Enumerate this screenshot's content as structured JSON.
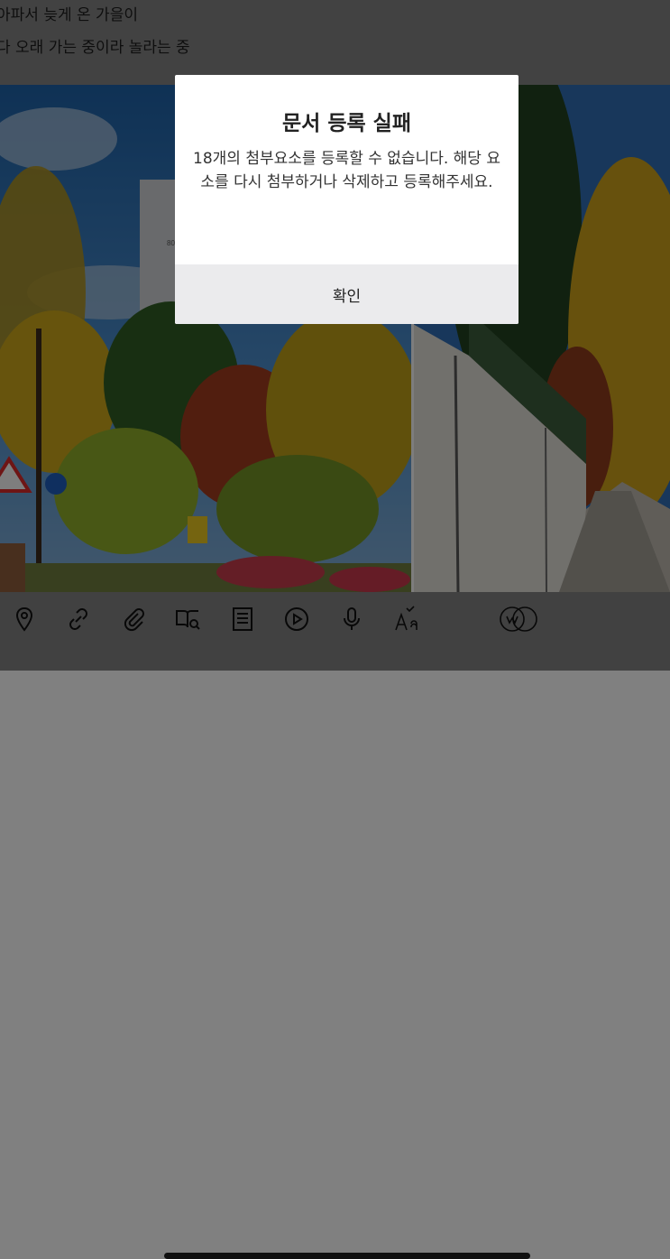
{
  "editor": {
    "line1": "아파서 늦게 온 가을이",
    "line2": "다 오래 가는 중이라 놀라는 중"
  },
  "dialog": {
    "title": "문서 등록 실패",
    "message": "18개의 첨부요소를 등록할 수 없습니다. 해당 요소를 다시 첨부하거나 삭제하고 등록해주세요.",
    "confirm_label": "확인"
  },
  "photo": {
    "left_sign_text": "80"
  },
  "toolbar": {
    "icons": [
      "location-pin-icon",
      "link-icon",
      "paperclip-icon",
      "book-search-icon",
      "document-icon",
      "video-play-icon",
      "microphone-icon",
      "spellcheck-icon",
      "ai-writing-icon"
    ]
  },
  "colors": {
    "dialog_bg": "#ffffff",
    "dialog_button_bg": "#ebebed",
    "dim_background": "#7f7f7f"
  }
}
